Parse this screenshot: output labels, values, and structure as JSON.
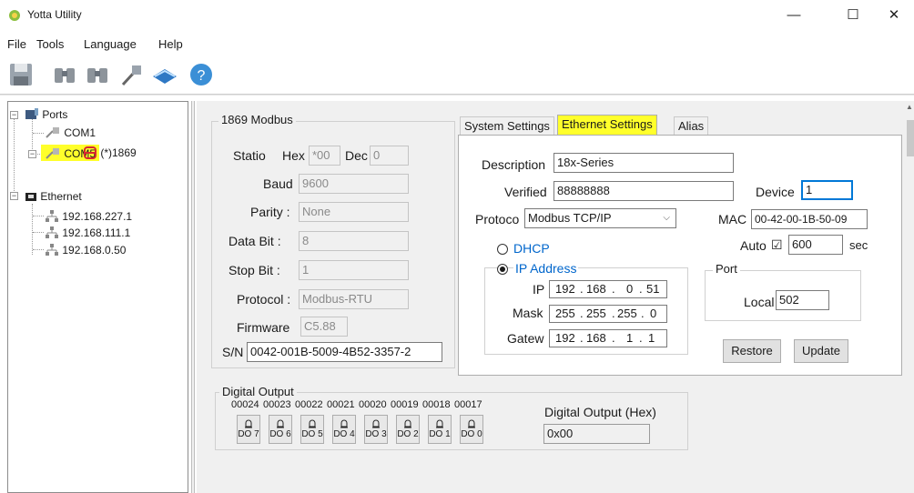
{
  "window": {
    "title": "Yotta Utility",
    "minimize": "—",
    "maximize": "☐",
    "close": "✕"
  },
  "menu": [
    "File",
    "Tools",
    "Language",
    "Help"
  ],
  "tree": {
    "ports": "Ports",
    "com1": "COM1",
    "com5": "COM5",
    "device": "(*)1869",
    "ethernet": "Ethernet",
    "hosts": [
      "192.168.227.1",
      "192.168.111.1",
      "192.168.0.50"
    ]
  },
  "modbus": {
    "group_title": "1869 Modbus",
    "station_label": "Statio",
    "hex_label": "Hex",
    "hex_value": "*00",
    "dec_label": "Dec",
    "dec_value": "0",
    "baud_label": "Baud",
    "baud_value": "9600",
    "parity_label": "Parity :",
    "parity_value": "None",
    "databit_label": "Data Bit :",
    "databit_value": "8",
    "stopbit_label": "Stop Bit :",
    "stopbit_value": "1",
    "protocol_label": "Protocol :",
    "protocol_value": "Modbus-RTU",
    "firmware_label": "Firmware",
    "firmware_value": "C5.88",
    "sn_label": "S/N",
    "sn_value": "0042-001B-5009-4B52-3357-2"
  },
  "tabs": [
    "System Settings",
    "Ethernet Settings",
    "Alias"
  ],
  "ethernet": {
    "description_label": "Description",
    "description_value": "18x-Series",
    "verified_label": "Verified",
    "verified_value": "88888888",
    "device_label": "Device",
    "device_value": "1",
    "protocol_label": "Protoco",
    "protocol_value": "Modbus TCP/IP",
    "mac_label": "MAC",
    "mac_value": "00-42-00-1B-50-09",
    "auto_label": "Auto",
    "auto_checked": "☑",
    "auto_value": "600",
    "sec_label": "sec",
    "dhcp_label": "DHCP",
    "ipaddr_label": "IP Address",
    "ip_label": "IP",
    "ip": [
      "192",
      "168",
      "0",
      "51"
    ],
    "mask_label": "Mask",
    "mask": [
      "255",
      "255",
      "255",
      "0"
    ],
    "gateway_label": "Gatew",
    "gateway": [
      "192",
      "168",
      "1",
      "1"
    ],
    "port_group": "Port",
    "local_label": "Local",
    "local_value": "502",
    "restore": "Restore",
    "update": "Update"
  },
  "digital_output": {
    "group_title": "Digital Output",
    "numbers": [
      "00024",
      "00023",
      "00022",
      "00021",
      "00020",
      "00019",
      "00018",
      "00017"
    ],
    "buttons": [
      "DO 7",
      "DO 6",
      "DO 5",
      "DO 4",
      "DO 3",
      "DO 2",
      "DO 1",
      "DO 0"
    ],
    "hex_label": "Digital Output (Hex)",
    "hex_value": "0x00"
  },
  "colors": {
    "highlight": "#ffff2b",
    "link_blue": "#0066cc",
    "focus_border": "#0078d7"
  }
}
